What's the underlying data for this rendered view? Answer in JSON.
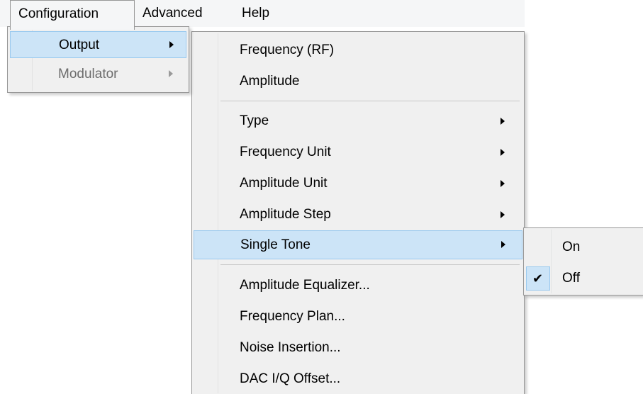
{
  "menubar": {
    "items": [
      "Configuration",
      "Advanced",
      "Help"
    ]
  },
  "configuration_menu": {
    "items": [
      {
        "label": "Output",
        "submenu": true,
        "highlighted": true,
        "enabled": true
      },
      {
        "label": "Modulator",
        "submenu": true,
        "highlighted": false,
        "enabled": false
      }
    ]
  },
  "output_menu": {
    "items": [
      {
        "label": "Frequency (RF)"
      },
      {
        "label": "Amplitude"
      },
      {
        "label": "Type",
        "submenu": true
      },
      {
        "label": "Frequency Unit",
        "submenu": true
      },
      {
        "label": "Amplitude Unit",
        "submenu": true
      },
      {
        "label": "Amplitude Step",
        "submenu": true
      },
      {
        "label": "Single Tone",
        "submenu": true,
        "highlighted": true
      },
      {
        "label": "Amplitude Equalizer..."
      },
      {
        "label": "Frequency Plan..."
      },
      {
        "label": "Noise Insertion..."
      },
      {
        "label": "DAC I/Q Offset..."
      }
    ]
  },
  "single_tone_menu": {
    "items": [
      {
        "label": "On",
        "checked": false
      },
      {
        "label": "Off",
        "checked": true
      }
    ],
    "check_glyph": "✔"
  },
  "colors": {
    "highlight": "#cce4f7",
    "highlight_border": "#99c9ef",
    "menu_bg": "#f0f0f0",
    "disabled_text": "#6d6d6d"
  },
  "icons": {
    "submenu_arrow": "chevron-right-icon",
    "check": "checkmark-icon"
  }
}
